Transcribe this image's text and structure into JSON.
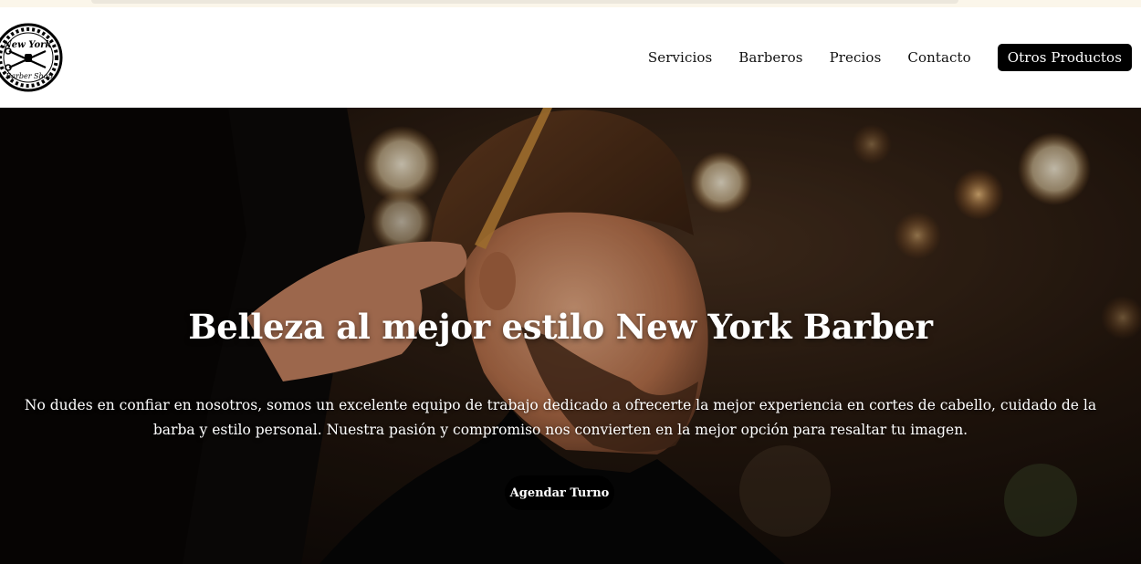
{
  "logo": {
    "line1": "New York",
    "line2": "Barber Shop",
    "icon": "crossed-scissors-razor-icon"
  },
  "nav": {
    "items": [
      {
        "label": "Servicios"
      },
      {
        "label": "Barberos"
      },
      {
        "label": "Precios"
      },
      {
        "label": "Contacto"
      }
    ],
    "cta": "Otros Productos"
  },
  "hero": {
    "title": "Belleza al mejor estilo New York Barber",
    "text": "No dudes en confiar en nosotros, somos un excelente equipo de trabajo dedicado a ofrecerte la mejor experiencia en cortes de cabello, cuidado de la barba y estilo personal. Nuestra pasión y compromiso nos convierten en la mejor opción para resaltar tu imagen.",
    "button": "Agendar Turno",
    "image": "barber-cutting-mans-hair-photo"
  },
  "colors": {
    "accent": "#000000",
    "header_bg": "#ffffff",
    "hero_text": "#ffffff",
    "top_strip": "#fbf6ea"
  }
}
